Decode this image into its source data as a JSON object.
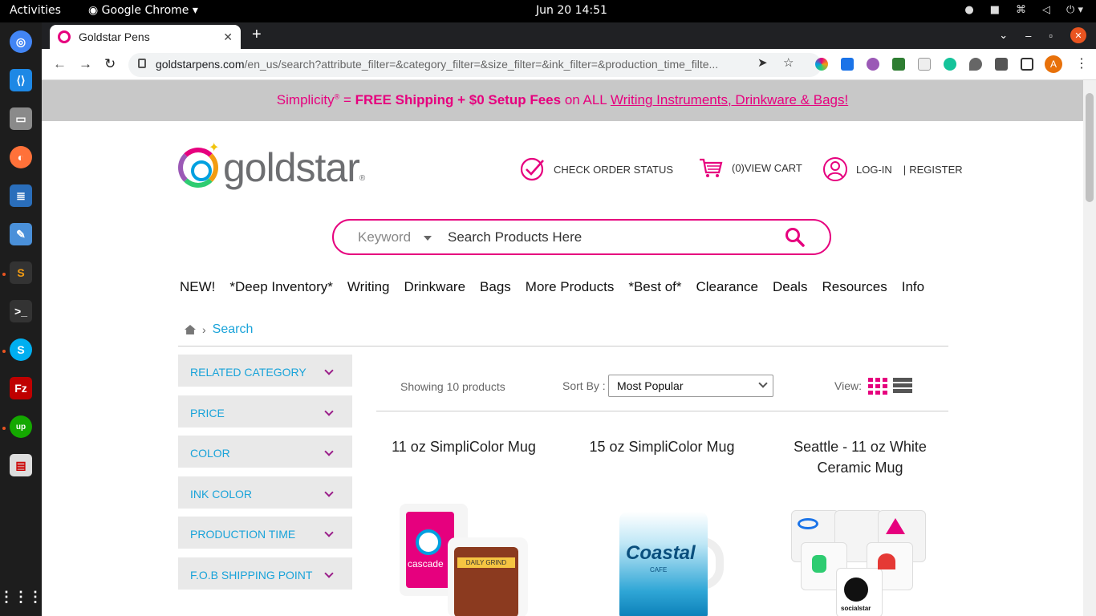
{
  "os": {
    "activities": "Activities",
    "app_name": "Google Chrome",
    "clock": "Jun 20  14:51"
  },
  "browser": {
    "tab_title": "Goldstar Pens",
    "url_domain": "goldstarpens.com",
    "url_path": "/en_us/search?attribute_filter=&category_filter=&size_filter=&ink_filter=&production_time_filte...",
    "profile_initial": "A"
  },
  "promo": {
    "prefix": "Simplicity",
    "reg": "®",
    "eq": " = ",
    "bold": "FREE Shipping + $0 Setup Fees",
    "on_all": " on ALL ",
    "link": "Writing Instruments, Drinkware & Bags!"
  },
  "header": {
    "logo_text": "goldstar",
    "logo_reg": "®",
    "check_order": "CHECK ORDER STATUS",
    "cart": "(0)VIEW CART",
    "login": "LOG-IN",
    "sep": "|",
    "register": "REGISTER"
  },
  "search": {
    "keyword_label": "Keyword",
    "placeholder": "Search Products Here"
  },
  "menu": [
    "NEW!",
    "*Deep Inventory*",
    "Writing",
    "Drinkware",
    "Bags",
    "More Products",
    "*Best of*",
    "Clearance",
    "Deals",
    "Resources",
    "Info"
  ],
  "breadcrumb": {
    "current": "Search"
  },
  "filters": [
    "RELATED CATEGORY",
    "PRICE",
    "COLOR",
    "INK COLOR",
    "PRODUCTION TIME",
    "F.O.B SHIPPING POINT"
  ],
  "results": {
    "showing": "Showing 10 products",
    "sort_label": "Sort By :",
    "sort_value": "Most Popular",
    "view_label": "View:"
  },
  "products": [
    {
      "title": "11 oz SimpliColor Mug",
      "brand": "cascade",
      "brand2": "DAILY GRIND"
    },
    {
      "title": "15 oz SimpliColor Mug",
      "brand": "Coastal",
      "brand_sub": "CAFE"
    },
    {
      "title": "Seattle - 11 oz White Ceramic Mug",
      "brand": "socialstar"
    }
  ],
  "colors": {
    "accent": "#e6007e",
    "link": "#19a3d9",
    "filter_bg": "#e9e9e9",
    "promo_bg": "#c8c8c8"
  }
}
